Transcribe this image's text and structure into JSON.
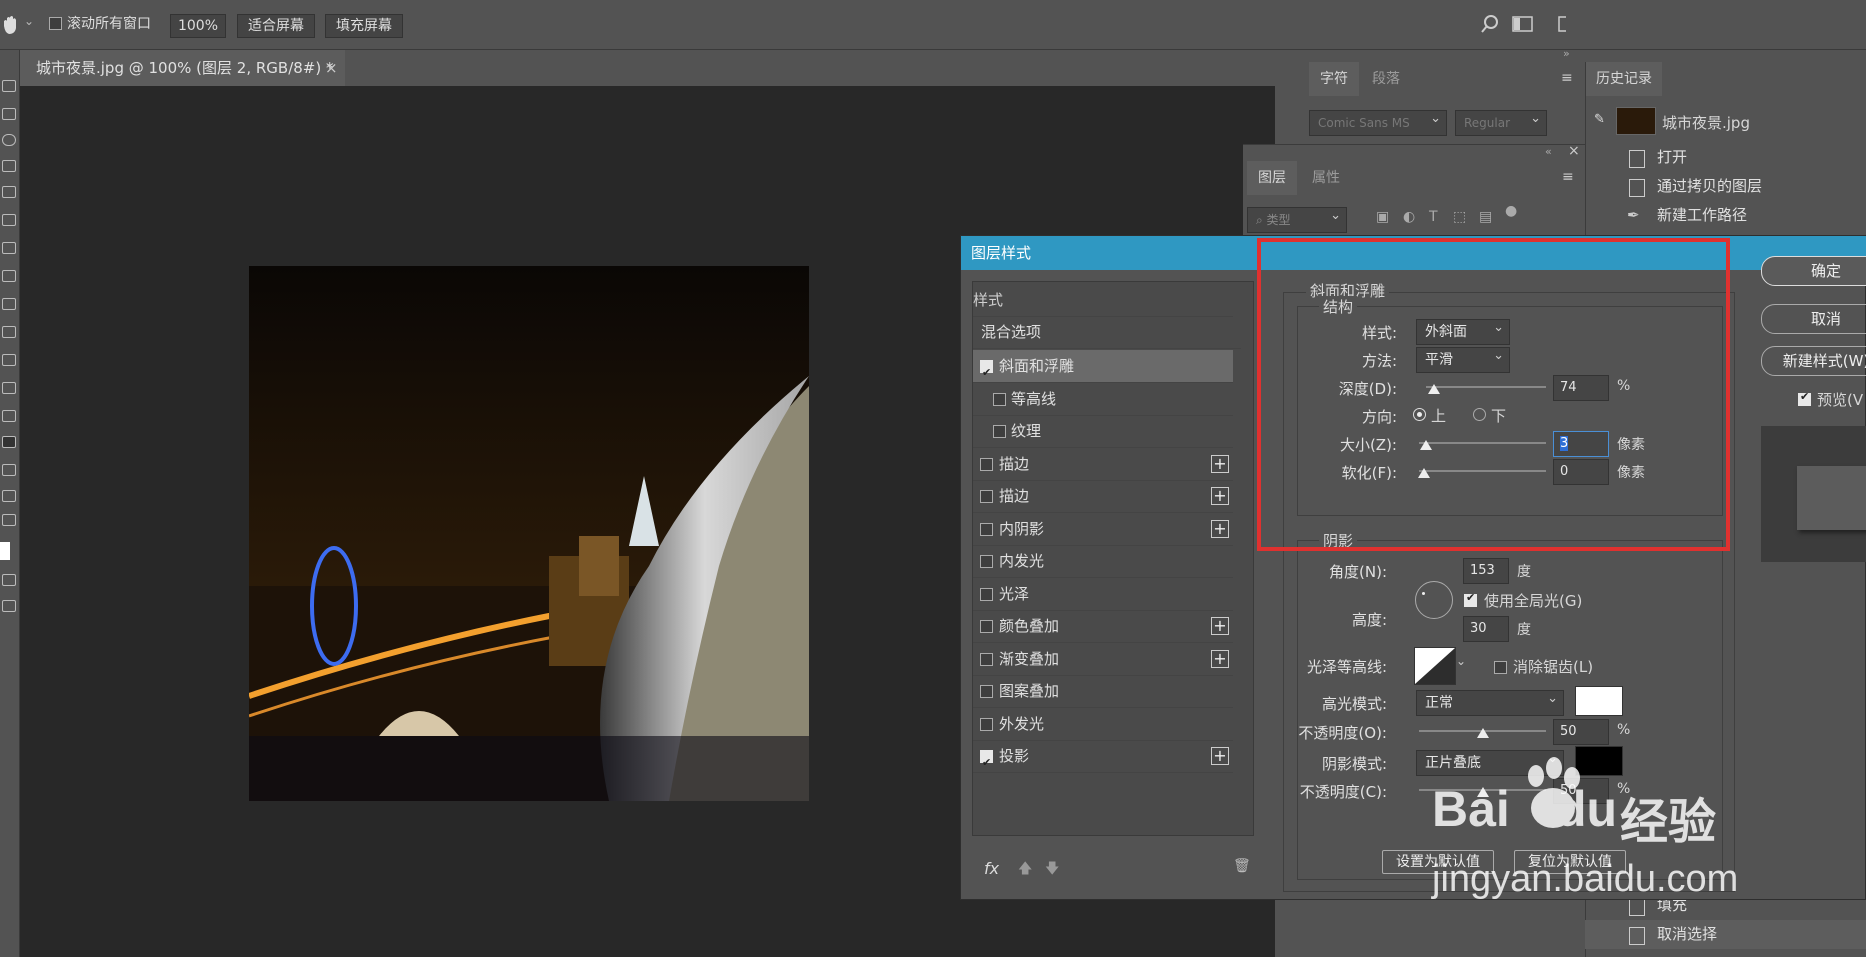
{
  "options_bar": {
    "scroll_all_label": "滚动所有窗口",
    "zoom_value": "100%",
    "fit_screen": "适合屏幕",
    "fill_screen": "填充屏幕"
  },
  "document": {
    "tab_title": "城市夜景.jpg @ 100% (图层 2, RGB/8#) *",
    "close": "×"
  },
  "char_panel": {
    "tabs": [
      "字符",
      "段落"
    ],
    "font_family": "Comic Sans MS",
    "font_style": "Regular"
  },
  "layers_panel": {
    "tabs": [
      "图层",
      "属性"
    ],
    "filter_placeholder": "类型"
  },
  "history_panel": {
    "title": "历史记录",
    "snapshot": "城市夜景.jpg",
    "items": [
      "打开",
      "通过拷贝的图层",
      "新建工作路径"
    ],
    "bottom_items": [
      "填充",
      "取消选择"
    ]
  },
  "dialog": {
    "title": "图层样式",
    "styles_header": "样式",
    "blend_options": "混合选项",
    "styles": [
      {
        "label": "斜面和浮雕",
        "checked": true,
        "plus": false,
        "indent": false,
        "active": true
      },
      {
        "label": "等高线",
        "checked": false,
        "plus": false,
        "indent": true
      },
      {
        "label": "纹理",
        "checked": false,
        "plus": false,
        "indent": true
      },
      {
        "label": "描边",
        "checked": false,
        "plus": true,
        "indent": false
      },
      {
        "label": "描边",
        "checked": false,
        "plus": true,
        "indent": false
      },
      {
        "label": "内阴影",
        "checked": false,
        "plus": true,
        "indent": false
      },
      {
        "label": "内发光",
        "checked": false,
        "plus": false,
        "indent": false
      },
      {
        "label": "光泽",
        "checked": false,
        "plus": false,
        "indent": false
      },
      {
        "label": "颜色叠加",
        "checked": false,
        "plus": true,
        "indent": false
      },
      {
        "label": "渐变叠加",
        "checked": false,
        "plus": true,
        "indent": false
      },
      {
        "label": "图案叠加",
        "checked": false,
        "plus": false,
        "indent": false
      },
      {
        "label": "外发光",
        "checked": false,
        "plus": false,
        "indent": false
      },
      {
        "label": "投影",
        "checked": true,
        "plus": true,
        "indent": false
      }
    ],
    "fx_label": "fx",
    "bevel": {
      "section_title": "斜面和浮雕",
      "structure_title": "结构",
      "style_label": "样式:",
      "style_value": "外斜面",
      "technique_label": "方法:",
      "technique_value": "平滑",
      "depth_label": "深度(D):",
      "depth_value": "74",
      "depth_unit": "%",
      "direction_label": "方向:",
      "direction_up": "上",
      "direction_down": "下",
      "size_label": "大小(Z):",
      "size_value": "3",
      "size_unit": "像素",
      "soften_label": "软化(F):",
      "soften_value": "0",
      "soften_unit": "像素"
    },
    "shading": {
      "title": "阴影",
      "angle_label": "角度(N):",
      "angle_value": "153",
      "angle_unit": "度",
      "global_light_label": "使用全局光(G)",
      "altitude_label": "高度:",
      "altitude_value": "30",
      "altitude_unit": "度",
      "gloss_label": "光泽等高线:",
      "antialias_label": "消除锯齿(L)",
      "highlight_mode_label": "高光模式:",
      "highlight_mode_value": "正常",
      "highlight_opacity_label": "不透明度(O):",
      "highlight_opacity_value": "50",
      "highlight_opacity_unit": "%",
      "shadow_mode_label": "阴影模式:",
      "shadow_mode_value": "正片叠底",
      "shadow_opacity_label": "不透明度(C):",
      "shadow_opacity_value": "50",
      "shadow_opacity_unit": "%"
    },
    "make_default": "设置为默认值",
    "reset_default": "复位为默认值",
    "ok": "确定",
    "cancel": "取消",
    "new_style": "新建样式(W)",
    "preview": "预览(V"
  },
  "watermark": {
    "brand": "Bai",
    "brand2": "du",
    "cn": "经验",
    "url": "jingyan.baidu.com"
  },
  "colors": {
    "dialog_title_bar": "#2f98c2",
    "highlight_box": "#e0312f",
    "panel_bg": "#535353",
    "canvas_bg": "#282828"
  }
}
